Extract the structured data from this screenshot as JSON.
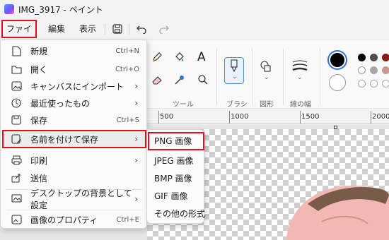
{
  "title": "IMG_3917 - ペイント",
  "menubar": {
    "file": "ファイル",
    "edit": "編集",
    "view": "表示"
  },
  "ribbon": {
    "tools_label": "ツール",
    "brush_label": "ブラシ",
    "shapes_label": "図形",
    "line_width_label": "線の幅",
    "text_tool": "A"
  },
  "ruler": {
    "labels": [
      "500",
      "1000",
      "1500",
      "2000"
    ]
  },
  "file_menu": {
    "items": [
      {
        "label": "新規",
        "shortcut": "Ctrl+N"
      },
      {
        "label": "開く",
        "shortcut": "Ctrl+O"
      },
      {
        "label": "キャンバスにインポート",
        "arrow": "›"
      },
      {
        "label": "最近使ったもの",
        "arrow": "›"
      },
      {
        "label": "保存",
        "shortcut": "Ctrl+S"
      },
      {
        "label": "名前を付けて保存",
        "arrow": "›"
      },
      {
        "label": "印刷",
        "arrow": "›"
      },
      {
        "label": "送信"
      },
      {
        "label": "デスクトップの背景として設定",
        "arrow": "›"
      },
      {
        "label": "画像のプロパティ",
        "shortcut": "Ctrl+E"
      }
    ]
  },
  "save_as_menu": {
    "items": [
      "PNG 画像",
      "JPEG 画像",
      "BMP 画像",
      "GIF 画像",
      "その他の形式"
    ]
  },
  "colors": {
    "accent": "#e0111e",
    "primary": "#000000",
    "secondary": "#ffffff",
    "palette_row1": [
      "#000000",
      "#4d4d4d",
      "#8a1b1b",
      "#e81123"
    ],
    "palette_row2": [
      "#ffffff",
      "#a8a8a8",
      "#c69a8d",
      "#ffc0cb"
    ]
  }
}
